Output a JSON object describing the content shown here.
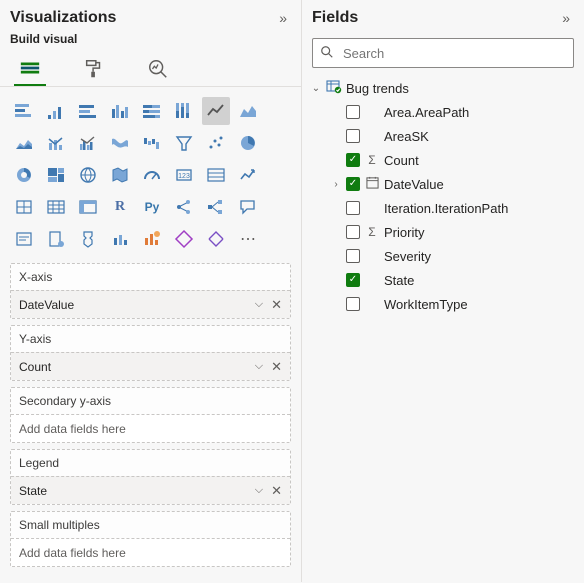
{
  "viz": {
    "title": "Visualizations",
    "subtitle": "Build visual",
    "wells": {
      "xaxis": {
        "label": "X-axis",
        "value": "DateValue"
      },
      "yaxis": {
        "label": "Y-axis",
        "value": "Count"
      },
      "secyaxis": {
        "label": "Secondary y-axis",
        "placeholder": "Add data fields here"
      },
      "legend": {
        "label": "Legend",
        "value": "State"
      },
      "smallmult": {
        "label": "Small multiples",
        "placeholder": "Add data fields here"
      }
    }
  },
  "fields": {
    "title": "Fields",
    "search_placeholder": "Search",
    "dataset": "Bug trends",
    "items": [
      {
        "name": "Area.AreaPath",
        "checked": false,
        "icon": ""
      },
      {
        "name": "AreaSK",
        "checked": false,
        "icon": ""
      },
      {
        "name": "Count",
        "checked": true,
        "icon": "sigma"
      },
      {
        "name": "DateValue",
        "checked": true,
        "icon": "calendar",
        "expandable": true
      },
      {
        "name": "Iteration.IterationPath",
        "checked": false,
        "icon": ""
      },
      {
        "name": "Priority",
        "checked": false,
        "icon": "sigma"
      },
      {
        "name": "Severity",
        "checked": false,
        "icon": ""
      },
      {
        "name": "State",
        "checked": true,
        "icon": ""
      },
      {
        "name": "WorkItemType",
        "checked": false,
        "icon": ""
      }
    ]
  }
}
